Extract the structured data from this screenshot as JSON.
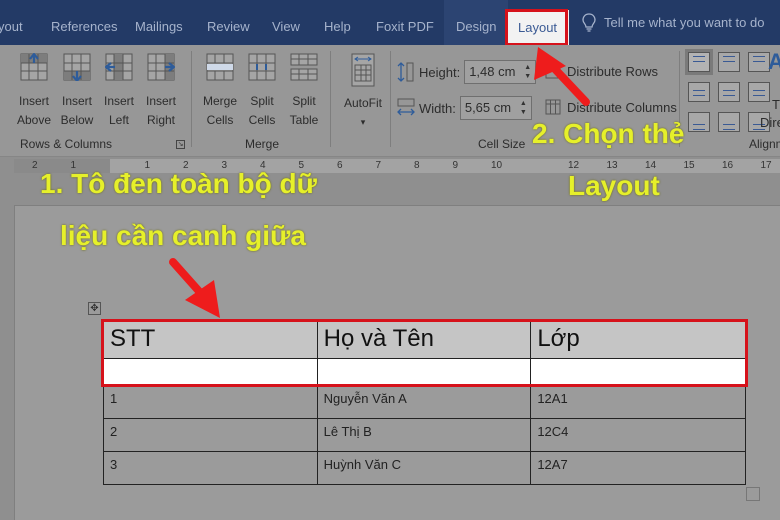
{
  "tabs": [
    {
      "label": "yout"
    },
    {
      "label": "References"
    },
    {
      "label": "Mailings"
    },
    {
      "label": "Review"
    },
    {
      "label": "View"
    },
    {
      "label": "Help"
    },
    {
      "label": "Foxit PDF"
    },
    {
      "label": "Design"
    },
    {
      "label": "Layout",
      "active": true
    }
  ],
  "tell_me": {
    "icon": "lightbulb-icon",
    "text": "Tell me what you want to do"
  },
  "ribbon": {
    "rows_columns": {
      "label": "Rows & Columns",
      "buttons": [
        {
          "line1": "Insert",
          "line2": "Above"
        },
        {
          "line1": "Insert",
          "line2": "Below"
        },
        {
          "line1": "Insert",
          "line2": "Left"
        },
        {
          "line1": "Insert",
          "line2": "Right"
        }
      ]
    },
    "merge": {
      "label": "Merge",
      "buttons": [
        {
          "line1": "Merge",
          "line2": "Cells"
        },
        {
          "line1": "Split",
          "line2": "Cells"
        },
        {
          "line1": "Split",
          "line2": "Table"
        }
      ]
    },
    "autofit": {
      "label": "AutoFit",
      "dropdown": "▾"
    },
    "cell_size": {
      "label": "Cell Size",
      "height_label": "Height:",
      "height_value": "1,48 cm",
      "width_label": "Width:",
      "width_value": "5,65 cm",
      "distribute_rows": "Distribute Rows",
      "distribute_columns": "Distribute Columns"
    },
    "alignment": {
      "label": "Alignm",
      "text_direction_line1": "T",
      "text_direction_line2": "Dire"
    }
  },
  "ruler": {
    "left_ticks": [
      "2",
      "1"
    ],
    "ticks": [
      "1",
      "2",
      "3",
      "4",
      "5",
      "6",
      "7",
      "8",
      "9",
      "10",
      "12",
      "13",
      "14",
      "15",
      "16",
      "17"
    ]
  },
  "table": {
    "headers": [
      "STT",
      "Họ và Tên",
      "Lớp"
    ],
    "rows": [
      [
        "1",
        "Nguyễn Văn A",
        "12A1"
      ],
      [
        "2",
        "Lê Thị B",
        "12C4"
      ],
      [
        "3",
        "Huỳnh Văn C",
        "12A7"
      ]
    ]
  },
  "annotations": {
    "step1_line1": "1. Tô đen toàn bộ dữ",
    "step1_line2": "liệu cần canh giữa",
    "step2_line1": "2. Chọn thẻ",
    "step2_line2": "Layout"
  },
  "colors": {
    "tabbar": "#233a66",
    "highlight_red": "#d6121b",
    "annotation_yellow": "#e6f02a",
    "selected_header": "#c5c5c5"
  }
}
